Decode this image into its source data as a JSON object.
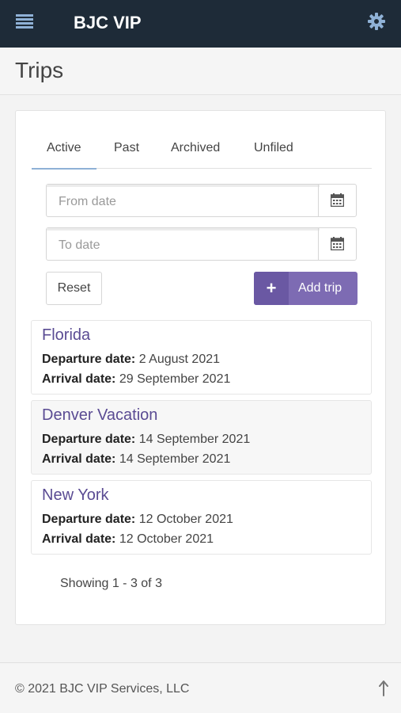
{
  "header": {
    "menu_icon": "hamburger-menu-icon",
    "app_title": "BJC VIP",
    "settings_icon": "gear-icon",
    "bar_color": "#1e2b38",
    "icon_color": "#8fb1d6"
  },
  "page": {
    "title": "Trips"
  },
  "tabs": [
    {
      "label": "Active",
      "active": true
    },
    {
      "label": "Past",
      "active": false
    },
    {
      "label": "Archived",
      "active": false
    },
    {
      "label": "Unfiled",
      "active": false
    }
  ],
  "filters": {
    "from_placeholder": "From date",
    "to_placeholder": "To date",
    "calendar_icon": "calendar-icon",
    "reset_label": "Reset",
    "add_label": "Add trip",
    "add_icon": "plus-icon",
    "accent_color": "#7d6bb3"
  },
  "trips": [
    {
      "name": "Florida",
      "departure_label": "Departure date:",
      "departure": "2 August 2021",
      "arrival_label": "Arrival date:",
      "arrival": "29 September 2021"
    },
    {
      "name": "Denver Vacation",
      "departure_label": "Departure date:",
      "departure": "14 September 2021",
      "arrival_label": "Arrival date:",
      "arrival": "14 September 2021"
    },
    {
      "name": "New York",
      "departure_label": "Departure date:",
      "departure": "12 October 2021",
      "arrival_label": "Arrival date:",
      "arrival": "12 October 2021"
    }
  ],
  "pagination": {
    "showing": "Showing 1 - 3 of 3"
  },
  "footer": {
    "copyright": "© 2021 BJC VIP Services, LLC",
    "scroll_top_icon": "arrow-up-icon"
  }
}
